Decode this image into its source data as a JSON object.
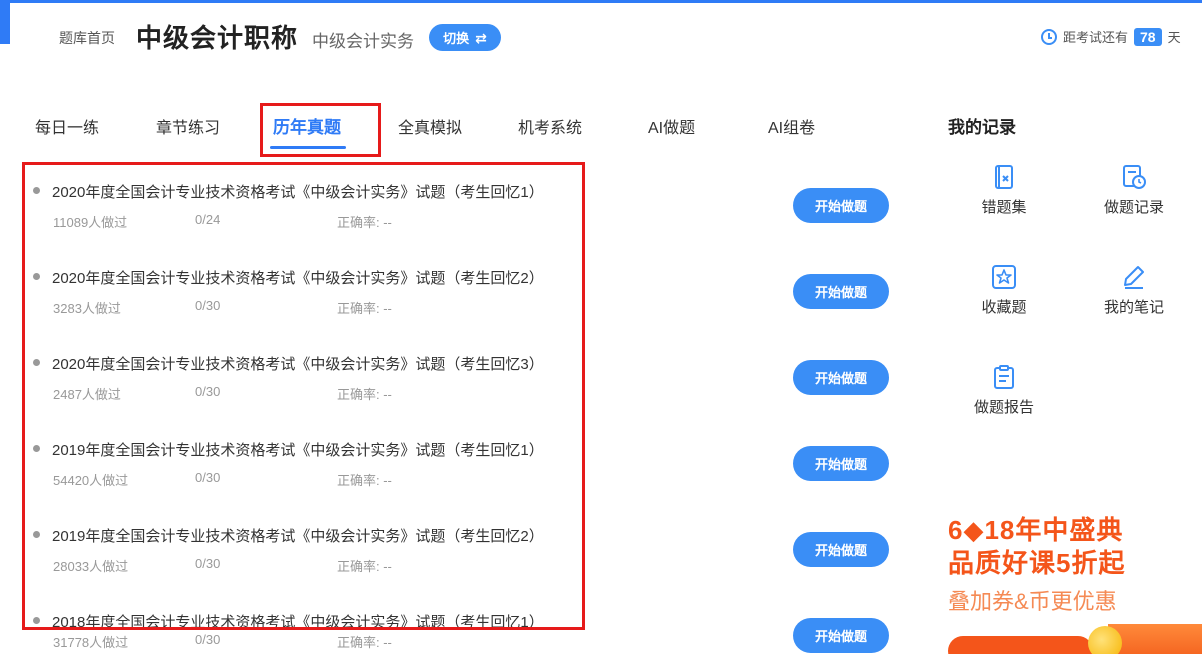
{
  "header": {
    "home_link": "题库首页",
    "exam_title": "中级会计职称",
    "subject": "中级会计实务",
    "switch_label": "切换",
    "countdown_prefix": "距考试还有",
    "countdown_days": "78",
    "countdown_suffix": "天"
  },
  "tabs": [
    {
      "label": "每日一练",
      "active": false
    },
    {
      "label": "章节练习",
      "active": false
    },
    {
      "label": "历年真题",
      "active": true
    },
    {
      "label": "全真模拟",
      "active": false
    },
    {
      "label": "机考系统",
      "active": false
    },
    {
      "label": "AI做题",
      "active": false
    },
    {
      "label": "AI组卷",
      "active": false
    }
  ],
  "papers": [
    {
      "title": "2020年度全国会计专业技术资格考试《中级会计实务》试题（考生回忆1）",
      "done": "11089人做过",
      "progress": "0/24",
      "accuracy": "正确率: --",
      "button": "开始做题"
    },
    {
      "title": "2020年度全国会计专业技术资格考试《中级会计实务》试题（考生回忆2）",
      "done": "3283人做过",
      "progress": "0/30",
      "accuracy": "正确率: --",
      "button": "开始做题"
    },
    {
      "title": "2020年度全国会计专业技术资格考试《中级会计实务》试题（考生回忆3）",
      "done": "2487人做过",
      "progress": "0/30",
      "accuracy": "正确率: --",
      "button": "开始做题"
    },
    {
      "title": "2019年度全国会计专业技术资格考试《中级会计实务》试题（考生回忆1）",
      "done": "54420人做过",
      "progress": "0/30",
      "accuracy": "正确率: --",
      "button": "开始做题"
    },
    {
      "title": "2019年度全国会计专业技术资格考试《中级会计实务》试题（考生回忆2）",
      "done": "28033人做过",
      "progress": "0/30",
      "accuracy": "正确率: --",
      "button": "开始做题"
    },
    {
      "title": "2018年度全国会计专业技术资格考试《中级会计实务》试题（考生回忆1）",
      "done": "31778人做过",
      "progress": "0/30",
      "accuracy": "正确率: --",
      "button": "开始做题"
    }
  ],
  "records": {
    "title": "我的记录",
    "items": [
      {
        "label": "错题集",
        "icon": "wrong-book-icon"
      },
      {
        "label": "做题记录",
        "icon": "history-icon"
      },
      {
        "label": "收藏题",
        "icon": "star-icon"
      },
      {
        "label": "我的笔记",
        "icon": "pen-icon"
      },
      {
        "label": "做题报告",
        "icon": "report-icon"
      }
    ]
  },
  "promo": {
    "line1": "6◆18年中盛典",
    "line2": "品质好课5折起",
    "line3": "叠加券&币更优惠"
  },
  "colors": {
    "accent": "#3a8ef6",
    "highlight": "#e61a1a",
    "promo": "#f4551a"
  }
}
